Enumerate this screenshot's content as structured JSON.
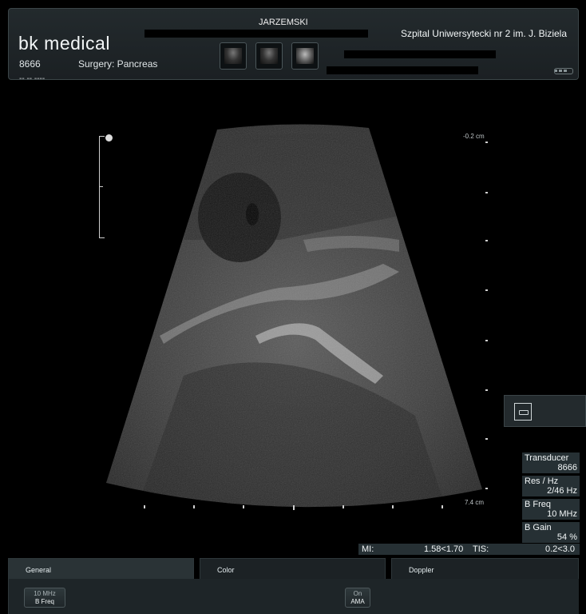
{
  "header": {
    "brand": "bk medical",
    "patient_id": "8666",
    "procedure": "Surgery: Pancreas",
    "patient_name": "JARZEMSKI",
    "hospital": "Szpital Uniwersytecki nr 2 im. J. Biziela",
    "date_partial": "-- -- ----",
    "thumbnails": [
      {
        "name": "thumbnail-1"
      },
      {
        "name": "thumbnail-2"
      },
      {
        "name": "thumbnail-3"
      }
    ]
  },
  "image": {
    "depth_top": "-0.2 cm",
    "depth_bottom": "7.4 cm"
  },
  "params": [
    {
      "label": "Transducer",
      "value": "8666"
    },
    {
      "label": "Res / Hz",
      "value": "2/46 Hz"
    },
    {
      "label": "B Freq",
      "value": "10 MHz"
    },
    {
      "label": "B Gain",
      "value": "54 %"
    }
  ],
  "indices": {
    "mi_label": "MI:",
    "mi_value": "1.58<1.70",
    "tis_label": "TIS:",
    "tis_value": "0.2<3.0"
  },
  "tabs": [
    {
      "label": "General",
      "active": true
    },
    {
      "label": "Color",
      "active": false
    },
    {
      "label": "Doppler",
      "active": false
    }
  ],
  "controls": {
    "bfreq_value": "10 MHz",
    "bfreq_label": "B Freq",
    "ama_value": "On",
    "ama_label": "AMA"
  },
  "colors": {
    "panel": "#232a2d",
    "param_bg": "#263034",
    "accent_text": "#f2f6f7"
  }
}
